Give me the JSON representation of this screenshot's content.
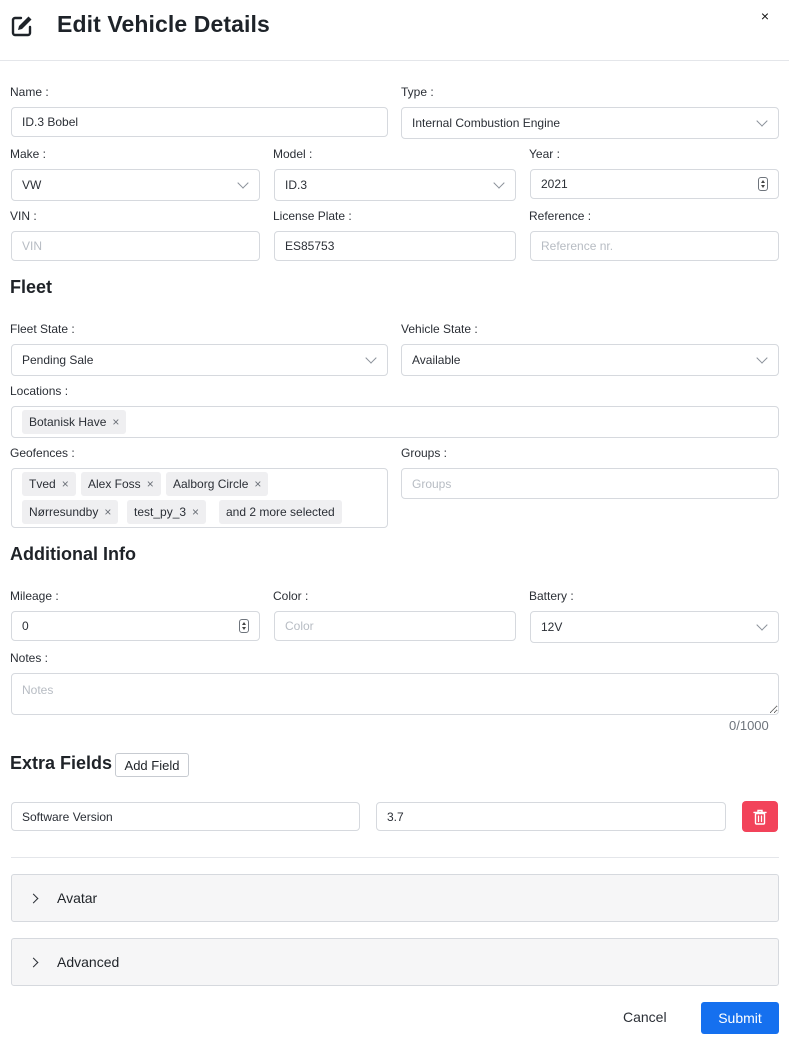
{
  "header": {
    "title": "Edit Vehicle Details",
    "close_glyph": "×"
  },
  "vehicle": {
    "name_label": "Name :",
    "name_value": "ID.3 Bobel",
    "type_label": "Type :",
    "type_value": "Internal Combustion Engine",
    "make_label": "Make :",
    "make_value": "VW",
    "model_label": "Model :",
    "model_value": "ID.3",
    "year_label": "Year :",
    "year_value": "2021",
    "vin_label": "VIN :",
    "vin_placeholder": "VIN",
    "plate_label": "License Plate :",
    "plate_value": "ES85753",
    "reference_label": "Reference :",
    "reference_placeholder": "Reference nr."
  },
  "fleet": {
    "title": "Fleet",
    "fleet_state_label": "Fleet State :",
    "fleet_state_value": "Pending Sale",
    "vehicle_state_label": "Vehicle State :",
    "vehicle_state_value": "Available",
    "locations_label": "Locations :",
    "locations": [
      "Botanisk Have"
    ],
    "geofences_label": "Geofences :",
    "geofences": [
      "Tved",
      "Alex Foss",
      "Aalborg Circle",
      "Nørresundby",
      "test_py_3"
    ],
    "geofences_more": "and 2 more selected",
    "groups_label": "Groups :",
    "groups_placeholder": "Groups",
    "remove_glyph": "×"
  },
  "additional": {
    "title": "Additional Info",
    "mileage_label": "Mileage :",
    "mileage_value": "0",
    "color_label": "Color :",
    "color_placeholder": "Color",
    "battery_label": "Battery :",
    "battery_value": "12V",
    "notes_label": "Notes :",
    "notes_placeholder": "Notes",
    "notes_counter": "0/1000"
  },
  "extra": {
    "title": "Extra Fields",
    "add_label": "Add Field",
    "field_name": "Software Version",
    "field_value": "3.7"
  },
  "accordions": {
    "avatar": "Avatar",
    "advanced": "Advanced"
  },
  "footer": {
    "cancel": "Cancel",
    "submit": "Submit"
  },
  "colors": {
    "primary": "#1570ef",
    "danger": "#f2435a",
    "border": "#d6d9de"
  }
}
